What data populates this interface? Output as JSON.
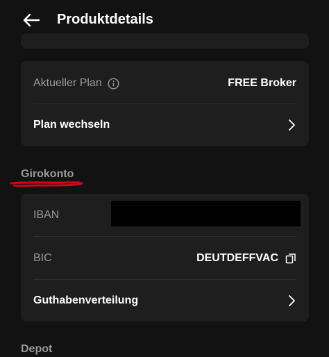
{
  "header": {
    "title": "Produktdetails",
    "back_icon": "arrow-left-icon"
  },
  "plan_card": {
    "current_plan_label": "Aktueller Plan",
    "info_icon": "info-icon",
    "current_plan_value": "FREE Broker",
    "change_plan_label": "Plan wechseln",
    "chevron_icon": "chevron-right-icon"
  },
  "giro_section": {
    "title": "Girokonto",
    "underline_color": "#d0021b",
    "iban_label": "IBAN",
    "iban_value": "",
    "bic_label": "BIC",
    "bic_value": "DEUTDEFFVAC",
    "copy_icon": "copy-icon",
    "balance_label": "Guthabenverteilung",
    "chevron_icon": "chevron-right-icon"
  },
  "depot_section": {
    "title": "Depot"
  },
  "colors": {
    "background": "#121212",
    "card": "#1e1e1e",
    "muted_text": "#9a9a9a",
    "annotation_red": "#d0021b"
  }
}
